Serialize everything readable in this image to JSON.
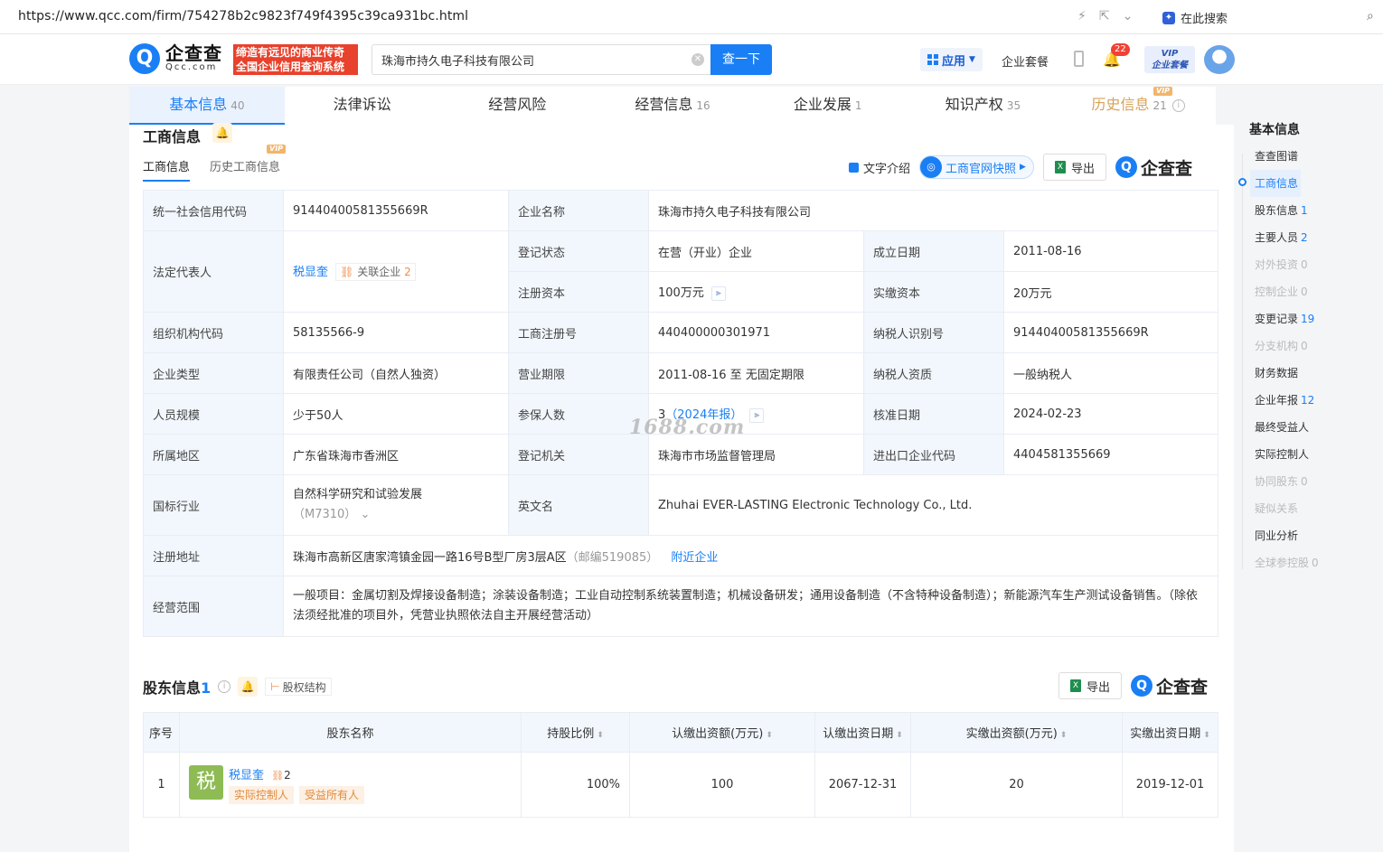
{
  "browser": {
    "url": "https://www.qcc.com/firm/754278b2c9823f749f4395c39ca931bc.html",
    "search_label": "在此搜索"
  },
  "header": {
    "logo_cn": "企查查",
    "logo_en": "Qcc.com",
    "slogan_line1": "缔造有远见的商业传奇",
    "slogan_line2": "全国企业信用查询系统",
    "search_value": "珠海市持久电子科技有限公司",
    "search_button": "查一下",
    "app_label": "应用",
    "package_label": "企业套餐",
    "notification_count": "22",
    "vip_line1": "VIP",
    "vip_line2": "企业套餐"
  },
  "tabs": [
    {
      "label": "基本信息",
      "count": "40"
    },
    {
      "label": "法律诉讼",
      "count": ""
    },
    {
      "label": "经营风险",
      "count": ""
    },
    {
      "label": "经营信息",
      "count": "16"
    },
    {
      "label": "企业发展",
      "count": "1"
    },
    {
      "label": "知识产权",
      "count": "35"
    },
    {
      "label": "历史信息",
      "count": "21",
      "vip": "VIP"
    }
  ],
  "business": {
    "title": "工商信息",
    "subtab_current": "工商信息",
    "subtab_history": "历史工商信息",
    "subtab_vip": "VIP",
    "text_intro": "文字介绍",
    "snapshot": "工商官网快照",
    "export": "导出",
    "brand": "企查查",
    "fields": {
      "credit_code_label": "统一社会信用代码",
      "credit_code": "91440400581355669R",
      "company_name_label": "企业名称",
      "company_name": "珠海市持久电子科技有限公司",
      "legal_rep_label": "法定代表人",
      "legal_rep": "税显奎",
      "related_label": "关联企业",
      "related_count": "2",
      "reg_status_label": "登记状态",
      "reg_status": "在营（开业）企业",
      "found_date_label": "成立日期",
      "found_date": "2011-08-16",
      "reg_capital_label": "注册资本",
      "reg_capital": "100万元",
      "paid_capital_label": "实缴资本",
      "paid_capital": "20万元",
      "org_code_label": "组织机构代码",
      "org_code": "58135566-9",
      "biz_reg_no_label": "工商注册号",
      "biz_reg_no": "440400000301971",
      "taxpayer_id_label": "纳税人识别号",
      "taxpayer_id": "91440400581355669R",
      "company_type_label": "企业类型",
      "company_type": "有限责任公司（自然人独资）",
      "biz_term_label": "营业期限",
      "biz_term": "2011-08-16 至 无固定期限",
      "taxpayer_qual_label": "纳税人资质",
      "taxpayer_qual": "一般纳税人",
      "staff_size_label": "人员规模",
      "staff_size": "少于50人",
      "insured_label": "参保人数",
      "insured_count": "3",
      "insured_report": "（2024年报）",
      "approve_date_label": "核准日期",
      "approve_date": "2024-02-23",
      "region_label": "所属地区",
      "region": "广东省珠海市香洲区",
      "reg_authority_label": "登记机关",
      "reg_authority": "珠海市市场监督管理局",
      "ie_code_label": "进出口企业代码",
      "ie_code": "4404581355669",
      "industry_label": "国标行业",
      "industry": "自然科学研究和试验发展",
      "industry_code": "（M7310）",
      "english_name_label": "英文名",
      "english_name": "Zhuhai EVER-LASTING Electronic Technology Co., Ltd.",
      "address_label": "注册地址",
      "address": "珠海市高新区唐家湾镇金园一路16号B型厂房3层A区",
      "postcode": "（邮编519085）",
      "nearby": "附近企业",
      "scope_label": "经营范围",
      "scope": "一般项目：金属切割及焊接设备制造；涂装设备制造；工业自动控制系统装置制造；机械设备研发；通用设备制造（不含特种设备制造）；新能源汽车生产测试设备销售。（除依法须经批准的项目外，凭营业执照依法自主开展经营活动）"
    }
  },
  "shareholders": {
    "title": "股东信息",
    "count": "1",
    "structure_btn": "股权结构",
    "export": "导出",
    "brand": "企查查",
    "columns": [
      "序号",
      "股东名称",
      "持股比例",
      "认缴出资额(万元)",
      "认缴出资日期",
      "实缴出资额(万元)",
      "实缴出资日期"
    ],
    "rows": [
      {
        "index": "1",
        "avatar": "税",
        "name": "税显奎",
        "related": "2",
        "roles": [
          "实际控制人",
          "受益所有人"
        ],
        "ratio": "100%",
        "subscribed": "100",
        "subscribed_date": "2067-12-31",
        "paid": "20",
        "paid_date": "2019-12-01"
      }
    ]
  },
  "sidenav": {
    "title": "基本信息",
    "items": [
      {
        "label": "查查图谱",
        "count": "",
        "state": "normal"
      },
      {
        "label": "工商信息",
        "count": "",
        "state": "active"
      },
      {
        "label": "股东信息",
        "count": "1",
        "state": "normal"
      },
      {
        "label": "主要人员",
        "count": "2",
        "state": "normal"
      },
      {
        "label": "对外投资",
        "count": "0",
        "state": "disabled"
      },
      {
        "label": "控制企业",
        "count": "0",
        "state": "disabled"
      },
      {
        "label": "变更记录",
        "count": "19",
        "state": "normal"
      },
      {
        "label": "分支机构",
        "count": "0",
        "state": "disabled"
      },
      {
        "label": "财务数据",
        "count": "",
        "state": "normal"
      },
      {
        "label": "企业年报",
        "count": "12",
        "state": "normal"
      },
      {
        "label": "最终受益人",
        "count": "",
        "state": "normal"
      },
      {
        "label": "实际控制人",
        "count": "",
        "state": "normal"
      },
      {
        "label": "协同股东",
        "count": "0",
        "state": "disabled"
      },
      {
        "label": "疑似关系",
        "count": "",
        "state": "disabled"
      },
      {
        "label": "同业分析",
        "count": "",
        "state": "normal"
      },
      {
        "label": "全球参控股",
        "count": "0",
        "state": "disabled"
      }
    ]
  },
  "watermark": "1688.com"
}
